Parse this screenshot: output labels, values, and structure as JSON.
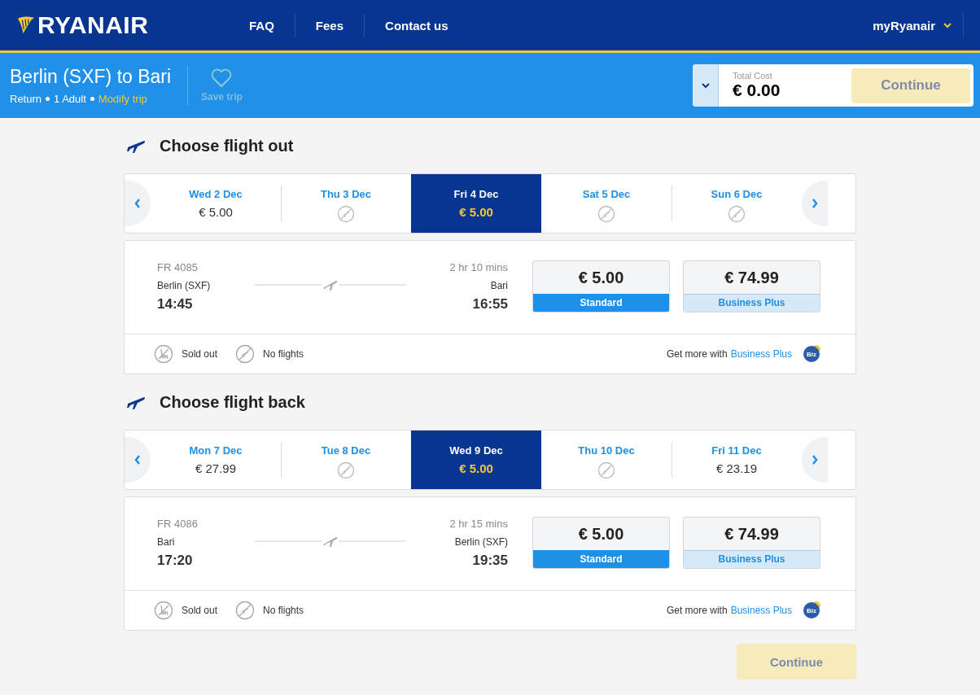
{
  "header": {
    "logo": "RYANAIR",
    "nav": [
      "FAQ",
      "Fees",
      "Contact us"
    ],
    "account": "myRyanair"
  },
  "trip": {
    "title": "Berlin (SXF) to Bari",
    "type": "Return",
    "passengers": "1 Adult",
    "modify": "Modify trip",
    "save": "Save trip"
  },
  "summary": {
    "label": "Total Cost",
    "total": "€ 0.00",
    "button": "Continue",
    "disabled": true
  },
  "sections": [
    {
      "title": "Choose flight out",
      "days": [
        {
          "day": "Wed 2 Dec",
          "kind": "price",
          "price": "€ 5.00",
          "selected": false
        },
        {
          "day": "Thu 3 Dec",
          "kind": "no-flights",
          "selected": false
        },
        {
          "day": "Fri 4 Dec",
          "kind": "price",
          "price": "€ 5.00",
          "selected": true
        },
        {
          "day": "Sat 5 Dec",
          "kind": "no-flights",
          "selected": false
        },
        {
          "day": "Sun 6 Dec",
          "kind": "no-flights",
          "selected": false
        }
      ],
      "flight": {
        "number": "FR 4085",
        "from": "Berlin (SXF)",
        "depart": "14:45",
        "duration": "2 hr 10 mins",
        "to": "Bari",
        "arrive": "16:55",
        "fares": [
          {
            "price": "€ 5.00",
            "name": "Standard",
            "selected": true
          },
          {
            "price": "€ 74.99",
            "name": "Business Plus",
            "selected": false
          }
        ]
      },
      "legend": [
        "Sold out",
        "No flights"
      ],
      "promo": {
        "text": "Get more with",
        "link": "Business Plus",
        "badge": "Biz"
      }
    },
    {
      "title": "Choose flight back",
      "days": [
        {
          "day": "Mon 7 Dec",
          "kind": "price",
          "price": "€ 27.99",
          "selected": false
        },
        {
          "day": "Tue 8 Dec",
          "kind": "no-flights",
          "selected": false
        },
        {
          "day": "Wed 9 Dec",
          "kind": "price",
          "price": "€ 5.00",
          "selected": true
        },
        {
          "day": "Thu 10 Dec",
          "kind": "no-flights",
          "selected": false
        },
        {
          "day": "Fri 11 Dec",
          "kind": "price",
          "price": "€ 23.19",
          "selected": false
        }
      ],
      "flight": {
        "number": "FR 4086",
        "from": "Bari",
        "depart": "17:20",
        "duration": "2 hr 15 mins",
        "to": "Berlin (SXF)",
        "arrive": "19:35",
        "fares": [
          {
            "price": "€ 5.00",
            "name": "Standard",
            "selected": true
          },
          {
            "price": "€ 74.99",
            "name": "Business Plus",
            "selected": false
          }
        ]
      },
      "legend": [
        "Sold out",
        "No flights"
      ],
      "promo": {
        "text": "Get more with",
        "link": "Business Plus",
        "badge": "Biz"
      }
    }
  ],
  "footer": {
    "button": "Continue",
    "disabled": true
  }
}
